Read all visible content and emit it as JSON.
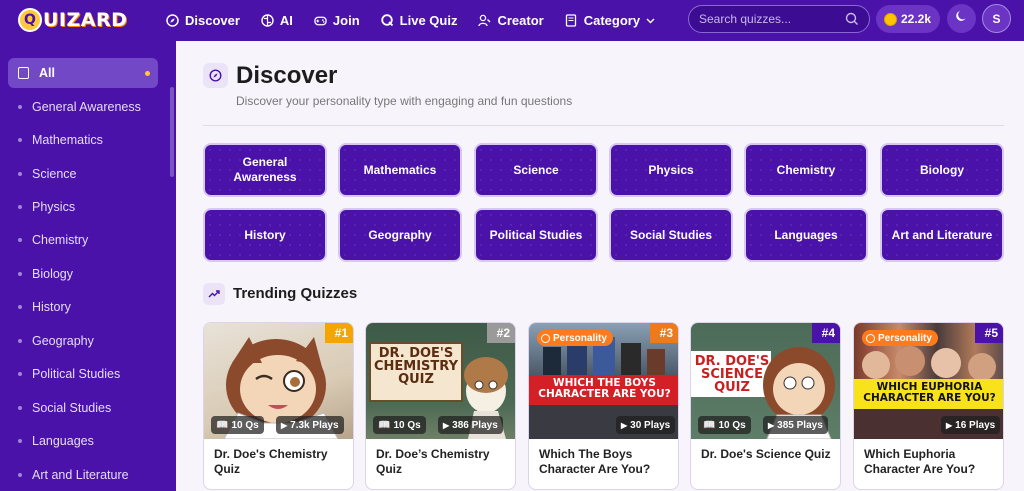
{
  "app": {
    "logo_initial": "Q",
    "logo_text": "UIZARD"
  },
  "nav": [
    {
      "label": "Discover",
      "icon": "compass-icon"
    },
    {
      "label": "AI",
      "icon": "brain-icon"
    },
    {
      "label": "Join",
      "icon": "gamepad-icon"
    },
    {
      "label": "Live Quiz",
      "icon": "live-quiz-icon"
    },
    {
      "label": "Creator",
      "icon": "creator-icon"
    },
    {
      "label": "Category",
      "icon": "book-icon"
    }
  ],
  "search": {
    "placeholder": "Search quizzes..."
  },
  "coins": {
    "value": "22.2k"
  },
  "user": {
    "initial": "S"
  },
  "sidebar": {
    "items": [
      {
        "label": "All"
      },
      {
        "label": "General Awareness"
      },
      {
        "label": "Mathematics"
      },
      {
        "label": "Science"
      },
      {
        "label": "Physics"
      },
      {
        "label": "Chemistry"
      },
      {
        "label": "Biology"
      },
      {
        "label": "History"
      },
      {
        "label": "Geography"
      },
      {
        "label": "Political Studies"
      },
      {
        "label": "Social Studies"
      },
      {
        "label": "Languages"
      },
      {
        "label": "Art and Literature"
      }
    ]
  },
  "page": {
    "title": "Discover",
    "subtitle": "Discover your personality type with engaging and fun questions"
  },
  "categories": [
    {
      "label": "General Awareness"
    },
    {
      "label": "Mathematics"
    },
    {
      "label": "Science"
    },
    {
      "label": "Physics"
    },
    {
      "label": "Chemistry"
    },
    {
      "label": "Biology"
    },
    {
      "label": "History"
    },
    {
      "label": "Geography"
    },
    {
      "label": "Political Studies"
    },
    {
      "label": "Social Studies"
    },
    {
      "label": "Languages"
    },
    {
      "label": "Art and Literature"
    }
  ],
  "trending": {
    "title": "Trending Quizzes",
    "cards": [
      {
        "rank": "#1",
        "rank_color": "#f5a500",
        "questions": "10 Qs",
        "plays": "7.3k Plays",
        "title": "Dr. Doe's Chemistry Quiz"
      },
      {
        "rank": "#2",
        "rank_color": "#9a9a9a",
        "questions": "10 Qs",
        "plays": "386 Plays",
        "title": "Dr. Doe’s Chemistry Quiz",
        "image_text": "DR. DOE'S CHEMISTRY QUIZ"
      },
      {
        "rank": "#3",
        "rank_color": "#ee7a1a",
        "badge": "Personality",
        "plays": "30 Plays",
        "title": "Which The Boys Character Are You?",
        "image_text": "WHICH THE BOYS CHARACTER ARE YOU?"
      },
      {
        "rank": "#4",
        "rank_color": "#4a12a8",
        "questions": "10 Qs",
        "plays": "385 Plays",
        "title": "Dr. Doe's Science Quiz",
        "image_text": "DR. DOE'S SCIENCE QUIZ"
      },
      {
        "rank": "#5",
        "rank_color": "#4a12a8",
        "badge": "Personality",
        "plays": "16 Plays",
        "title": "Which Euphoria Character Are You?",
        "image_text": "WHICH EUPHORIA CHARACTER ARE YOU?"
      }
    ]
  }
}
